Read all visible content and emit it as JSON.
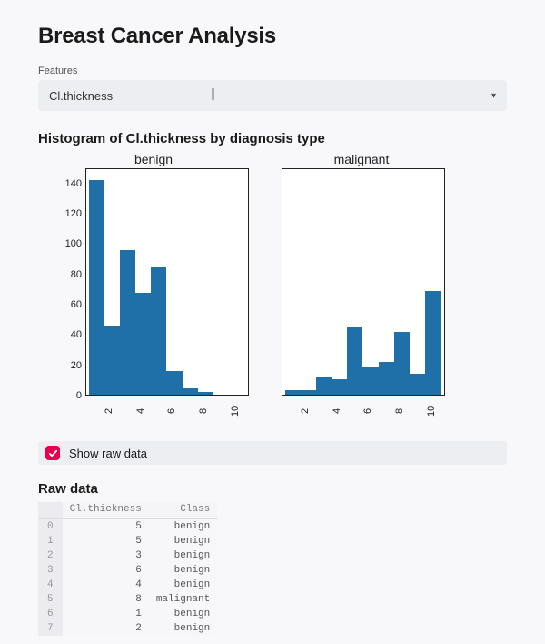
{
  "title": "Breast Cancer Analysis",
  "features": {
    "label": "Features",
    "selected": "Cl.thickness"
  },
  "histogram_heading": "Histogram of Cl.thickness by diagnosis type",
  "checkbox": {
    "label": "Show raw data",
    "checked": true
  },
  "raw_heading": "Raw data",
  "raw_columns": {
    "index": "",
    "feature": "Cl.thickness",
    "class": "Class"
  },
  "raw_rows": [
    {
      "idx": "0",
      "feature": "5",
      "class": "benign"
    },
    {
      "idx": "1",
      "feature": "5",
      "class": "benign"
    },
    {
      "idx": "2",
      "feature": "3",
      "class": "benign"
    },
    {
      "idx": "3",
      "feature": "6",
      "class": "benign"
    },
    {
      "idx": "4",
      "feature": "4",
      "class": "benign"
    },
    {
      "idx": "5",
      "feature": "8",
      "class": "malignant"
    },
    {
      "idx": "6",
      "feature": "1",
      "class": "benign"
    },
    {
      "idx": "7",
      "feature": "2",
      "class": "benign"
    }
  ],
  "chart_data": [
    {
      "type": "bar",
      "title": "benign",
      "xlabel": "",
      "ylabel": "",
      "ylim": [
        0,
        150
      ],
      "yticks": [
        0,
        20,
        40,
        60,
        80,
        100,
        120,
        140
      ],
      "categories": [
        "1",
        "2",
        "3",
        "4",
        "5",
        "6",
        "7",
        "8",
        "9",
        "10"
      ],
      "xticks": [
        "2",
        "4",
        "6",
        "8",
        "10"
      ],
      "values": [
        143,
        46,
        96,
        68,
        85,
        16,
        4,
        2,
        0,
        0
      ]
    },
    {
      "type": "bar",
      "title": "malignant",
      "xlabel": "",
      "ylabel": "",
      "ylim": [
        0,
        150
      ],
      "yticks": [
        0,
        20,
        40,
        60,
        80,
        100,
        120,
        140
      ],
      "categories": [
        "1",
        "2",
        "3",
        "4",
        "5",
        "6",
        "7",
        "8",
        "9",
        "10"
      ],
      "xticks": [
        "2",
        "4",
        "6",
        "8",
        "10"
      ],
      "values": [
        3,
        3,
        12,
        10,
        45,
        18,
        22,
        42,
        14,
        69
      ]
    }
  ]
}
